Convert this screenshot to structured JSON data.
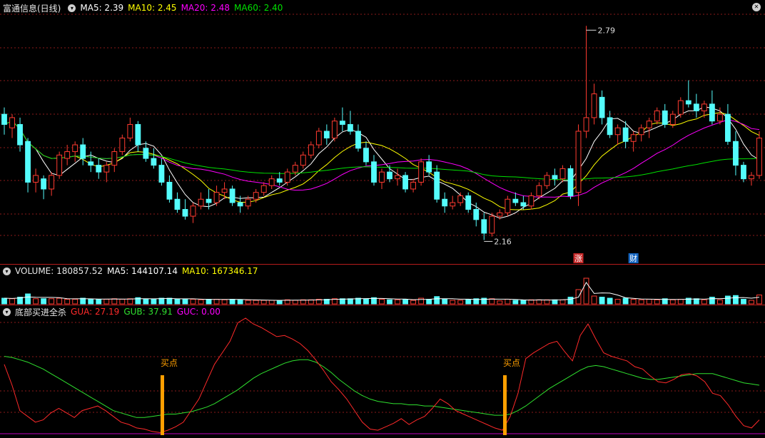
{
  "header": {
    "title": "富通信息(日线)",
    "ma5": "MA5: 2.39",
    "ma10": "MA10: 2.45",
    "ma20": "MA20: 2.48",
    "ma60": "MA60: 2.40"
  },
  "volume_header": {
    "label": "VOLUME: 180857.52",
    "ma5": "MA5: 144107.14",
    "ma10": "MA10: 167346.17"
  },
  "indicator_header": {
    "name": "底部买进全杀",
    "gua": "GUA: 27.19",
    "gub": "GUB: 37.91",
    "guc": "GUC: 0.00"
  },
  "annotations": {
    "high": "2.79",
    "low": "2.16",
    "badge_up": "涨",
    "badge_fin": "财",
    "buy1": "买点",
    "buy2": "买点"
  },
  "colors": {
    "up": "#ff3b30",
    "down": "#54fcfc",
    "ma5": "#ffffff",
    "ma10": "#ffff00",
    "ma20": "#ff00ff",
    "ma60": "#00e000",
    "gua": "#ff2a2a",
    "gub": "#2fe02f",
    "marker": "#ff9f00",
    "grid": "#8b1a1a"
  },
  "chart_data": [
    {
      "type": "candlestick",
      "series": "price",
      "high": 2.79,
      "low": 2.16,
      "ohlc": [
        [
          2.53,
          2.55,
          2.47,
          2.5
        ],
        [
          2.49,
          2.53,
          2.46,
          2.52
        ],
        [
          2.5,
          2.52,
          2.42,
          2.44
        ],
        [
          2.45,
          2.46,
          2.3,
          2.33
        ],
        [
          2.33,
          2.37,
          2.3,
          2.35
        ],
        [
          2.34,
          2.35,
          2.28,
          2.31
        ],
        [
          2.31,
          2.36,
          2.29,
          2.35
        ],
        [
          2.35,
          2.42,
          2.34,
          2.41
        ],
        [
          2.4,
          2.44,
          2.38,
          2.42
        ],
        [
          2.42,
          2.45,
          2.39,
          2.44
        ],
        [
          2.44,
          2.46,
          2.38,
          2.4
        ],
        [
          2.39,
          2.42,
          2.36,
          2.38
        ],
        [
          2.38,
          2.4,
          2.34,
          2.36
        ],
        [
          2.36,
          2.39,
          2.33,
          2.38
        ],
        [
          2.38,
          2.43,
          2.36,
          2.42
        ],
        [
          2.42,
          2.47,
          2.41,
          2.46
        ],
        [
          2.46,
          2.52,
          2.45,
          2.5
        ],
        [
          2.5,
          2.51,
          2.42,
          2.44
        ],
        [
          2.43,
          2.45,
          2.39,
          2.4
        ],
        [
          2.4,
          2.43,
          2.37,
          2.38
        ],
        [
          2.38,
          2.4,
          2.32,
          2.33
        ],
        [
          2.33,
          2.35,
          2.27,
          2.28
        ],
        [
          2.28,
          2.3,
          2.24,
          2.25
        ],
        [
          2.25,
          2.28,
          2.22,
          2.23
        ],
        [
          2.23,
          2.27,
          2.21,
          2.26
        ],
        [
          2.26,
          2.3,
          2.25,
          2.28
        ],
        [
          2.28,
          2.31,
          2.25,
          2.27
        ],
        [
          2.27,
          2.32,
          2.26,
          2.3
        ],
        [
          2.3,
          2.33,
          2.28,
          2.31
        ],
        [
          2.31,
          2.32,
          2.26,
          2.27
        ],
        [
          2.27,
          2.29,
          2.24,
          2.26
        ],
        [
          2.26,
          2.29,
          2.25,
          2.28
        ],
        [
          2.28,
          2.31,
          2.27,
          2.3
        ],
        [
          2.3,
          2.33,
          2.29,
          2.32
        ],
        [
          2.32,
          2.35,
          2.31,
          2.34
        ],
        [
          2.34,
          2.36,
          2.32,
          2.33
        ],
        [
          2.33,
          2.37,
          2.32,
          2.36
        ],
        [
          2.36,
          2.39,
          2.35,
          2.38
        ],
        [
          2.38,
          2.42,
          2.37,
          2.41
        ],
        [
          2.41,
          2.45,
          2.4,
          2.44
        ],
        [
          2.44,
          2.49,
          2.43,
          2.48
        ],
        [
          2.48,
          2.5,
          2.44,
          2.46
        ],
        [
          2.46,
          2.52,
          2.45,
          2.51
        ],
        [
          2.51,
          2.55,
          2.48,
          2.5
        ],
        [
          2.5,
          2.54,
          2.47,
          2.48
        ],
        [
          2.48,
          2.5,
          2.42,
          2.43
        ],
        [
          2.43,
          2.45,
          2.38,
          2.39
        ],
        [
          2.39,
          2.41,
          2.32,
          2.33
        ],
        [
          2.33,
          2.37,
          2.31,
          2.36
        ],
        [
          2.36,
          2.38,
          2.33,
          2.34
        ],
        [
          2.34,
          2.37,
          2.32,
          2.35
        ],
        [
          2.35,
          2.36,
          2.3,
          2.31
        ],
        [
          2.31,
          2.34,
          2.3,
          2.33
        ],
        [
          2.33,
          2.4,
          2.32,
          2.39
        ],
        [
          2.39,
          2.41,
          2.35,
          2.36
        ],
        [
          2.36,
          2.38,
          2.27,
          2.28
        ],
        [
          2.28,
          2.3,
          2.24,
          2.26
        ],
        [
          2.26,
          2.29,
          2.25,
          2.27
        ],
        [
          2.27,
          2.3,
          2.26,
          2.29
        ],
        [
          2.29,
          2.3,
          2.24,
          2.25
        ],
        [
          2.25,
          2.27,
          2.2,
          2.22
        ],
        [
          2.22,
          2.24,
          2.16,
          2.18
        ],
        [
          2.18,
          2.24,
          2.17,
          2.23
        ],
        [
          2.23,
          2.25,
          2.22,
          2.24
        ],
        [
          2.24,
          2.29,
          2.23,
          2.28
        ],
        [
          2.28,
          2.3,
          2.26,
          2.27
        ],
        [
          2.27,
          2.29,
          2.25,
          2.26
        ],
        [
          2.26,
          2.3,
          2.25,
          2.29
        ],
        [
          2.29,
          2.33,
          2.28,
          2.32
        ],
        [
          2.32,
          2.36,
          2.31,
          2.35
        ],
        [
          2.35,
          2.37,
          2.32,
          2.34
        ],
        [
          2.34,
          2.38,
          2.33,
          2.37
        ],
        [
          2.37,
          2.38,
          2.28,
          2.29
        ],
        [
          2.3,
          2.5,
          2.26,
          2.48
        ],
        [
          2.48,
          2.79,
          2.46,
          2.52
        ],
        [
          2.52,
          2.62,
          2.5,
          2.59
        ],
        [
          2.58,
          2.6,
          2.5,
          2.52
        ],
        [
          2.52,
          2.54,
          2.46,
          2.47
        ],
        [
          2.47,
          2.5,
          2.44,
          2.49
        ],
        [
          2.49,
          2.51,
          2.43,
          2.45
        ],
        [
          2.45,
          2.48,
          2.42,
          2.47
        ],
        [
          2.47,
          2.5,
          2.45,
          2.49
        ],
        [
          2.49,
          2.52,
          2.46,
          2.51
        ],
        [
          2.51,
          2.55,
          2.5,
          2.54
        ],
        [
          2.54,
          2.56,
          2.49,
          2.5
        ],
        [
          2.5,
          2.54,
          2.49,
          2.53
        ],
        [
          2.53,
          2.58,
          2.52,
          2.57
        ],
        [
          2.57,
          2.63,
          2.55,
          2.56
        ],
        [
          2.56,
          2.59,
          2.52,
          2.54
        ],
        [
          2.54,
          2.57,
          2.52,
          2.56
        ],
        [
          2.56,
          2.6,
          2.5,
          2.51
        ],
        [
          2.51,
          2.55,
          2.5,
          2.53
        ],
        [
          2.53,
          2.56,
          2.44,
          2.45
        ],
        [
          2.45,
          2.48,
          2.35,
          2.38
        ],
        [
          2.38,
          2.39,
          2.33,
          2.34
        ],
        [
          2.34,
          2.36,
          2.32,
          2.35
        ],
        [
          2.35,
          2.48,
          2.34,
          2.46
        ]
      ]
    },
    {
      "type": "line",
      "series": "indicator",
      "gua": [
        60,
        42,
        20,
        15,
        10,
        12,
        18,
        22,
        18,
        14,
        20,
        22,
        24,
        20,
        15,
        10,
        8,
        5,
        4,
        2,
        1,
        3,
        6,
        10,
        20,
        30,
        45,
        60,
        70,
        80,
        96,
        100,
        95,
        92,
        88,
        84,
        85,
        82,
        78,
        72,
        64,
        55,
        45,
        38,
        30,
        20,
        10,
        4,
        3,
        6,
        9,
        13,
        8,
        12,
        15,
        22,
        30,
        26,
        20,
        17,
        14,
        11,
        8,
        5,
        3,
        15,
        35,
        65,
        70,
        74,
        78,
        80,
        71,
        63,
        85,
        95,
        82,
        70,
        67,
        65,
        63,
        58,
        56,
        50,
        45,
        44,
        47,
        51,
        52,
        50,
        45,
        35,
        33,
        25,
        15,
        7,
        5,
        12
      ],
      "gub": [
        67,
        66,
        64,
        62,
        59,
        56,
        52,
        48,
        44,
        40,
        36,
        32,
        28,
        24,
        20,
        18,
        16,
        14,
        14,
        15,
        16,
        17,
        17,
        18,
        19,
        21,
        23,
        26,
        30,
        34,
        38,
        43,
        48,
        52,
        55,
        58,
        61,
        63,
        64,
        64,
        62,
        58,
        53,
        47,
        42,
        37,
        33,
        30,
        28,
        27,
        26,
        26,
        25,
        25,
        24,
        24,
        23,
        22,
        21,
        20,
        19,
        18,
        17,
        16,
        16,
        17,
        20,
        24,
        29,
        34,
        39,
        43,
        47,
        51,
        55,
        58,
        59,
        58,
        56,
        54,
        52,
        50,
        48,
        47,
        47,
        48,
        49,
        50,
        51,
        52,
        52,
        52,
        50,
        48,
        46,
        44,
        43,
        42
      ]
    }
  ]
}
